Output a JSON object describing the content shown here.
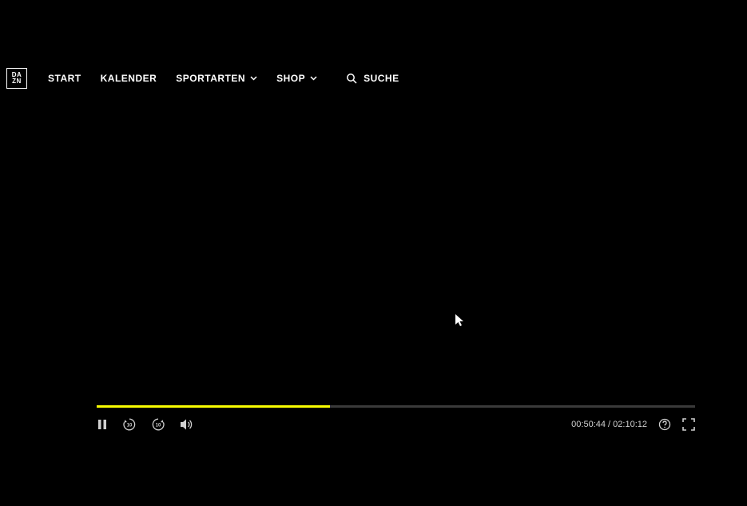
{
  "brand": {
    "logo_line1": "DA",
    "logo_line2": "ZN"
  },
  "nav": {
    "start": "START",
    "kalender": "KALENDER",
    "sportarten": "SPORTARTEN",
    "shop": "SHOP",
    "suche": "SUCHE"
  },
  "player": {
    "current_time": "00:50:44",
    "separator": " / ",
    "duration": "02:10:12",
    "progress_percent": 39,
    "accent_color": "#f8fc00"
  }
}
